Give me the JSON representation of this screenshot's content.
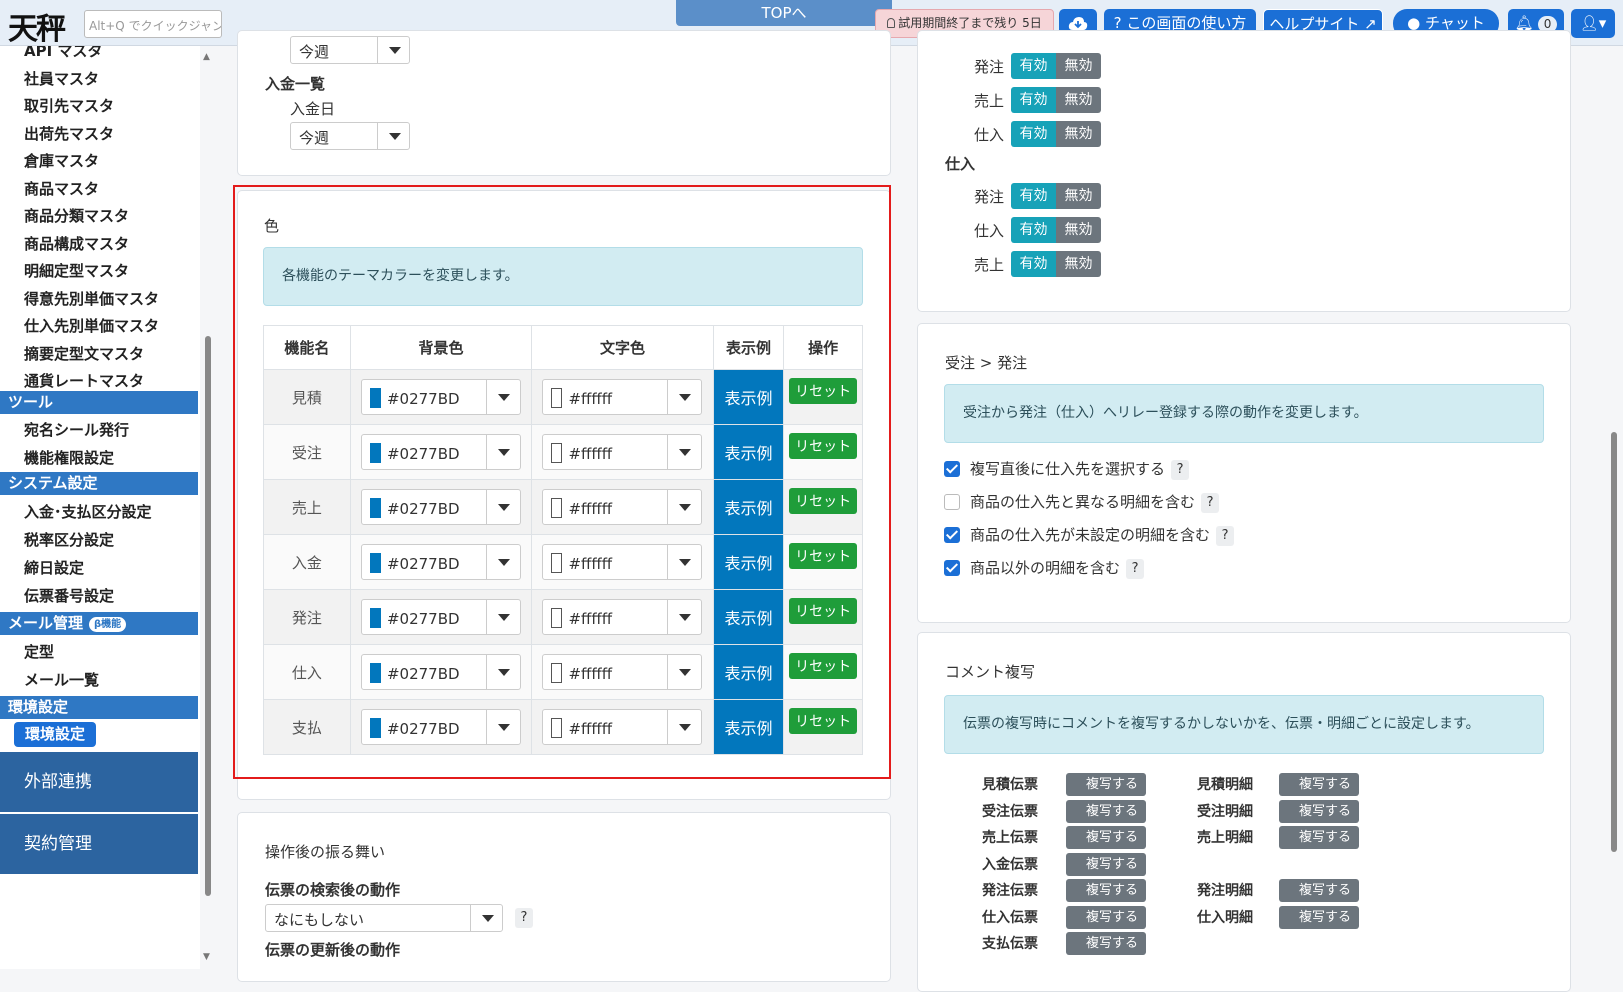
{
  "header": {
    "logo": "天秤",
    "quickjump_placeholder": "Alt+Q でクイックジャンプ",
    "top_tab": "TOPへ",
    "trial": "試用期間終了まで残り 5日",
    "help_label": "? この画面の使い方",
    "helpsite_label": "ヘルプサイト",
    "chat_label": "チャット",
    "notif_count": "0"
  },
  "sidebar": {
    "items_top": [
      "API マスタ",
      "社員マスタ",
      "取引先マスタ",
      "出荷先マスタ",
      "倉庫マスタ",
      "商品マスタ",
      "商品分類マスタ",
      "商品構成マスタ",
      "明細定型マスタ",
      "得意先別単価マスタ",
      "仕入先別単価マスタ",
      "摘要定型文マスタ",
      "通貨レートマスタ"
    ],
    "tools_head": "ツール",
    "tools": [
      "宛名シール発行",
      "機能権限設定"
    ],
    "system_head": "システム設定",
    "system": [
      "入金･支払区分設定",
      "税率区分設定",
      "締日設定",
      "伝票番号設定"
    ],
    "mail_head": "メール管理",
    "mail_beta": "β機能",
    "mail": [
      "定型",
      "メール一覧"
    ],
    "env_head": "環境設定",
    "env_active": "環境設定",
    "external": "外部連携",
    "contract": "契約管理"
  },
  "top_card": {
    "first_select": "今週",
    "payment_list": "入金一覧",
    "payment_date": "入金日",
    "payment_select": "今週"
  },
  "color_section": {
    "title": "色",
    "info": "各機能のテーマカラーを変更します。",
    "headers": [
      "機能名",
      "背景色",
      "文字色",
      "表示例",
      "操作"
    ],
    "rows": [
      {
        "name": "見積",
        "bg": "#0277BD",
        "fg": "#ffffff",
        "sample": "表示例",
        "reset": "リセット"
      },
      {
        "name": "受注",
        "bg": "#0277BD",
        "fg": "#ffffff",
        "sample": "表示例",
        "reset": "リセット"
      },
      {
        "name": "売上",
        "bg": "#0277BD",
        "fg": "#ffffff",
        "sample": "表示例",
        "reset": "リセット"
      },
      {
        "name": "入金",
        "bg": "#0277BD",
        "fg": "#ffffff",
        "sample": "表示例",
        "reset": "リセット"
      },
      {
        "name": "発注",
        "bg": "#0277BD",
        "fg": "#ffffff",
        "sample": "表示例",
        "reset": "リセット"
      },
      {
        "name": "仕入",
        "bg": "#0277BD",
        "fg": "#ffffff",
        "sample": "表示例",
        "reset": "リセット"
      },
      {
        "name": "支払",
        "bg": "#0277BD",
        "fg": "#ffffff",
        "sample": "表示例",
        "reset": "リセット"
      }
    ]
  },
  "after_section": {
    "title": "操作後の振る舞い",
    "search_label": "伝票の検索後の動作",
    "search_value": "なにもしない",
    "update_label": "伝票の更新後の動作"
  },
  "toggles": {
    "on": "有効",
    "off": "無効",
    "group1": [
      "発注",
      "売上",
      "仕入"
    ],
    "group2_title": "仕入",
    "group2": [
      "発注",
      "仕入",
      "売上"
    ]
  },
  "relay_section": {
    "title": "受注 > 発注",
    "info": "受注から発注（仕入）へリレー登録する際の動作を変更します。",
    "options": [
      {
        "label": "複写直後に仕入先を選択する",
        "checked": true
      },
      {
        "label": "商品の仕入先と異なる明細を含む",
        "checked": false
      },
      {
        "label": "商品の仕入先が未設定の明細を含む",
        "checked": true
      },
      {
        "label": "商品以外の明細を含む",
        "checked": true
      }
    ]
  },
  "comment_section": {
    "title": "コメント複写",
    "info": "伝票の複写時にコメントを複写するかしないかを、伝票・明細ごとに設定します。",
    "copy_label": "複写する",
    "slips": [
      "見積伝票",
      "受注伝票",
      "売上伝票",
      "入金伝票",
      "発注伝票",
      "仕入伝票",
      "支払伝票"
    ],
    "details": [
      "見積明細",
      "受注明細",
      "売上明細",
      "",
      "発注明細",
      "仕入明細",
      ""
    ]
  }
}
